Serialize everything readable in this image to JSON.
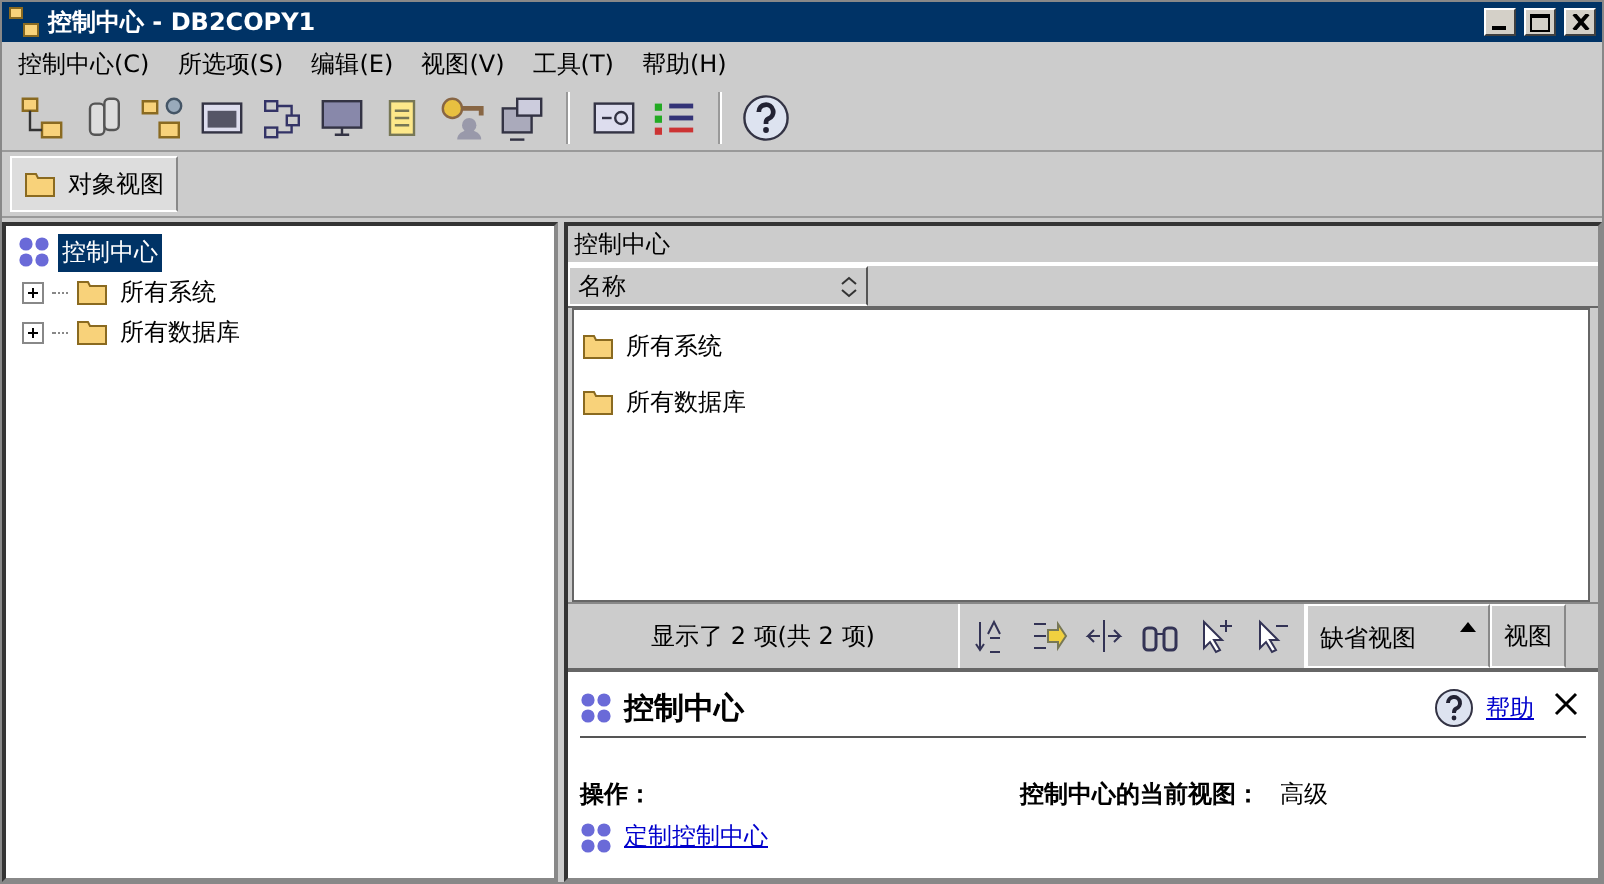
{
  "window": {
    "title": "控制中心 - DB2COPY1"
  },
  "menu": [
    "控制中心(C)",
    "所选项(S)",
    "编辑(E)",
    "视图(V)",
    "工具(T)",
    "帮助(H)"
  ],
  "tabs": [
    {
      "label": "对象视图",
      "selected": true
    }
  ],
  "tree": {
    "label": "控制中心",
    "selected": true,
    "children": [
      {
        "label": "所有系统",
        "expanded": false,
        "selected": false
      },
      {
        "label": "所有数据库",
        "expanded": false,
        "selected": false
      }
    ]
  },
  "content": {
    "breadcrumb": "控制中心",
    "columns": [
      "名称"
    ],
    "rows": [
      {
        "name": "所有系统",
        "selected": false
      },
      {
        "name": "所有数据库",
        "selected": false
      }
    ],
    "status": "显示了 2 项(共 2 项)",
    "view_dropdown": "缺省视图",
    "view_button": "视图"
  },
  "details": {
    "title": "控制中心",
    "help_link": "帮助",
    "actions_label": "操作：",
    "action_link": "定制控制中心",
    "current_view_label": "控制中心的当前视图：",
    "current_view_value": "高级"
  }
}
